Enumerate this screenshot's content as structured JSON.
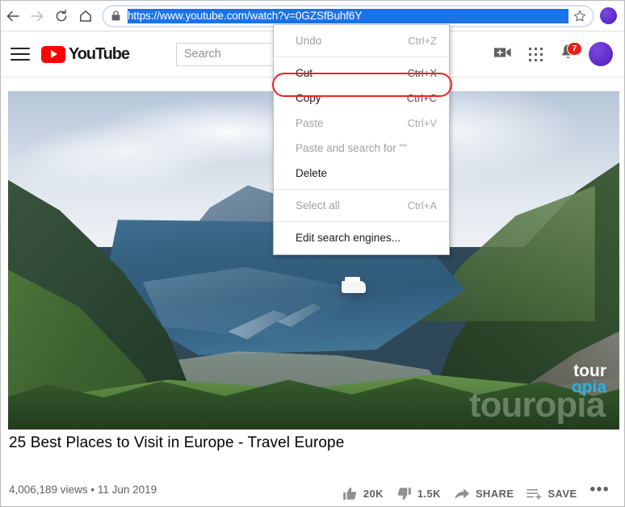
{
  "browser": {
    "back_icon": "arrow-left-icon",
    "forward_icon": "arrow-right-icon",
    "reload_icon": "reload-icon",
    "home_icon": "home-icon",
    "lock_icon": "lock-icon",
    "url": "https://www.youtube.com/watch?v=0GZSfBuhf6Y",
    "url_selected": true,
    "bookmark_icon": "star-icon",
    "profile_icon": "profile-avatar",
    "accent_selection_color": "#1a73e8"
  },
  "yt_header": {
    "menu_icon": "hamburger-menu-icon",
    "logo_text": "YouTube",
    "logo_icon": "youtube-play-icon",
    "search_placeholder": "Search",
    "create_icon": "video-camera-plus-icon",
    "apps_icon": "apps-grid-icon",
    "notifications_icon": "bell-icon",
    "notification_count": "7",
    "notification_badge_color": "#e62117",
    "avatar_icon": "account-avatar",
    "brand_color": "#ff0000"
  },
  "context_menu": {
    "items": [
      {
        "label": "Undo",
        "accel": "Ctrl+Z",
        "disabled": true,
        "separator_after": true
      },
      {
        "label": "Cut",
        "accel": "Ctrl+X",
        "disabled": false,
        "separator_after": false
      },
      {
        "label": "Copy",
        "accel": "Ctrl+C",
        "disabled": false,
        "separator_after": false
      },
      {
        "label": "Paste",
        "accel": "Ctrl+V",
        "disabled": true,
        "separator_after": false
      },
      {
        "label": "Paste and search for \"\"",
        "accel": "",
        "disabled": true,
        "separator_after": false
      },
      {
        "label": "Delete",
        "accel": "",
        "disabled": false,
        "separator_after": true
      },
      {
        "label": "Select all",
        "accel": "Ctrl+A",
        "disabled": true,
        "separator_after": true
      },
      {
        "label": "Edit search engines...",
        "accel": "",
        "disabled": false,
        "separator_after": false
      }
    ],
    "highlighted_item": "Copy",
    "highlight_color": "#ee2222"
  },
  "video": {
    "title": "25 Best Places to Visit in Europe - Travel Europe",
    "views": "4,006,189 views",
    "separator": "•",
    "date": "11 Jun 2019",
    "watermark_part1": "tour",
    "watermark_part2": "opia",
    "watermark_full": "touropia",
    "watermark_accent_color": "#23b5e8",
    "thumbnail_alt": "Geirangerfjord Norway aerial view with cruise ship"
  },
  "actions": {
    "like_icon": "thumbs-up-icon",
    "like_count": "20K",
    "dislike_icon": "thumbs-down-icon",
    "dislike_count": "1.5K",
    "share_icon": "share-arrow-icon",
    "share_label": "SHARE",
    "save_icon": "save-playlist-icon",
    "save_label": "SAVE",
    "more_icon": "more-horizontal-icon",
    "more_label": "•••"
  }
}
